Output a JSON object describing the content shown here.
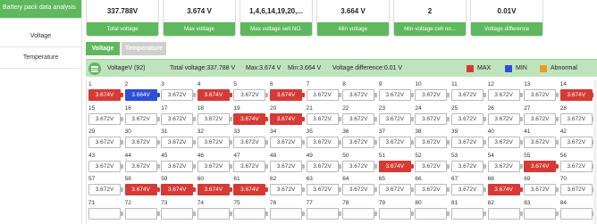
{
  "sidebar": {
    "items": [
      {
        "label": "Battery pack data analysis",
        "active": true
      },
      {
        "label": "Voltage",
        "active": false
      },
      {
        "label": "Temperature",
        "active": false
      }
    ]
  },
  "summary": [
    {
      "value": "337.788V",
      "label": "Total voltage"
    },
    {
      "value": "3.674 V",
      "label": "Max voltage"
    },
    {
      "value": "1,4,6,14,19,20,...",
      "label": "Max voltage sell NO."
    },
    {
      "value": "3.664 V",
      "label": "Min voltage"
    },
    {
      "value": "2",
      "label": "Min-voltage cell no..."
    },
    {
      "value": "0.01V",
      "label": "Voltage difference"
    }
  ],
  "tabs": {
    "active": "Voltage",
    "inactive": "Temperature"
  },
  "panel": {
    "title": "VoltageV (92)",
    "total": "Total voltage:337.788 V",
    "max": "Max:3.674 V",
    "min": "Min:3.664 V",
    "diff": "Voltage difference:0.01 V",
    "legend": [
      {
        "label": "MAX",
        "color": "#d63a35"
      },
      {
        "label": "MIN",
        "color": "#2f4fd6"
      },
      {
        "label": "Abnormal",
        "color": "#ef9a1f"
      }
    ]
  },
  "cells": [
    {
      "no": "1",
      "v": "3.674V",
      "s": "max"
    },
    {
      "no": "2",
      "v": "3.664V",
      "s": "min"
    },
    {
      "no": "3",
      "v": "3.672V",
      "s": "normal"
    },
    {
      "no": "4",
      "v": "3.674V",
      "s": "max"
    },
    {
      "no": "5",
      "v": "3.672V",
      "s": "normal"
    },
    {
      "no": "6",
      "v": "3.674V",
      "s": "max"
    },
    {
      "no": "7",
      "v": "3.672V",
      "s": "normal"
    },
    {
      "no": "8",
      "v": "3.672V",
      "s": "normal"
    },
    {
      "no": "9",
      "v": "3.672V",
      "s": "normal"
    },
    {
      "no": "10",
      "v": "3.672V",
      "s": "normal"
    },
    {
      "no": "11",
      "v": "3.672V",
      "s": "normal"
    },
    {
      "no": "12",
      "v": "3.672V",
      "s": "normal"
    },
    {
      "no": "13",
      "v": "3.672V",
      "s": "normal"
    },
    {
      "no": "14",
      "v": "3.674V",
      "s": "max"
    },
    {
      "no": "15",
      "v": "3.672V",
      "s": "normal"
    },
    {
      "no": "16",
      "v": "3.672V",
      "s": "normal"
    },
    {
      "no": "17",
      "v": "3.672V",
      "s": "normal"
    },
    {
      "no": "18",
      "v": "3.672V",
      "s": "normal"
    },
    {
      "no": "19",
      "v": "3.674V",
      "s": "max"
    },
    {
      "no": "20",
      "v": "3.674V",
      "s": "max"
    },
    {
      "no": "21",
      "v": "3.672V",
      "s": "normal"
    },
    {
      "no": "22",
      "v": "3.672V",
      "s": "normal"
    },
    {
      "no": "23",
      "v": "3.672V",
      "s": "normal"
    },
    {
      "no": "24",
      "v": "3.672V",
      "s": "normal"
    },
    {
      "no": "25",
      "v": "3.672V",
      "s": "normal"
    },
    {
      "no": "26",
      "v": "3.672V",
      "s": "normal"
    },
    {
      "no": "27",
      "v": "3.672V",
      "s": "normal"
    },
    {
      "no": "28",
      "v": "3.672V",
      "s": "normal"
    },
    {
      "no": "29",
      "v": "3.672V",
      "s": "normal"
    },
    {
      "no": "30",
      "v": "3.672V",
      "s": "normal"
    },
    {
      "no": "31",
      "v": "3.672V",
      "s": "normal"
    },
    {
      "no": "32",
      "v": "3.672V",
      "s": "normal"
    },
    {
      "no": "33",
      "v": "3.672V",
      "s": "normal"
    },
    {
      "no": "34",
      "v": "3.672V",
      "s": "normal"
    },
    {
      "no": "35",
      "v": "3.672V",
      "s": "normal"
    },
    {
      "no": "36",
      "v": "3.672V",
      "s": "normal"
    },
    {
      "no": "37",
      "v": "3.672V",
      "s": "normal"
    },
    {
      "no": "38",
      "v": "3.672V",
      "s": "normal"
    },
    {
      "no": "39",
      "v": "3.672V",
      "s": "normal"
    },
    {
      "no": "40",
      "v": "3.672V",
      "s": "normal"
    },
    {
      "no": "41",
      "v": "3.672V",
      "s": "normal"
    },
    {
      "no": "42",
      "v": "3.672V",
      "s": "normal"
    },
    {
      "no": "43",
      "v": "3.672V",
      "s": "normal"
    },
    {
      "no": "44",
      "v": "3.672V",
      "s": "normal"
    },
    {
      "no": "45",
      "v": "3.672V",
      "s": "normal"
    },
    {
      "no": "46",
      "v": "3.672V",
      "s": "normal"
    },
    {
      "no": "47",
      "v": "3.672V",
      "s": "normal"
    },
    {
      "no": "48",
      "v": "3.672V",
      "s": "normal"
    },
    {
      "no": "49",
      "v": "3.672V",
      "s": "normal"
    },
    {
      "no": "50",
      "v": "3.672V",
      "s": "normal"
    },
    {
      "no": "51",
      "v": "3.674V",
      "s": "max"
    },
    {
      "no": "52",
      "v": "3.672V",
      "s": "normal"
    },
    {
      "no": "53",
      "v": "3.672V",
      "s": "normal"
    },
    {
      "no": "54",
      "v": "3.672V",
      "s": "normal"
    },
    {
      "no": "55",
      "v": "3.674V",
      "s": "max"
    },
    {
      "no": "56",
      "v": "3.672V",
      "s": "normal"
    },
    {
      "no": "57",
      "v": "3.672V",
      "s": "normal"
    },
    {
      "no": "58",
      "v": "3.674V",
      "s": "max"
    },
    {
      "no": "59",
      "v": "3.674V",
      "s": "max"
    },
    {
      "no": "60",
      "v": "3.674V",
      "s": "max"
    },
    {
      "no": "61",
      "v": "3.674V",
      "s": "max"
    },
    {
      "no": "62",
      "v": "3.672V",
      "s": "normal"
    },
    {
      "no": "63",
      "v": "3.672V",
      "s": "normal"
    },
    {
      "no": "64",
      "v": "3.672V",
      "s": "normal"
    },
    {
      "no": "65",
      "v": "3.672V",
      "s": "normal"
    },
    {
      "no": "66",
      "v": "3.672V",
      "s": "normal"
    },
    {
      "no": "67",
      "v": "3.672V",
      "s": "normal"
    },
    {
      "no": "68",
      "v": "3.674V",
      "s": "max"
    },
    {
      "no": "69",
      "v": "3.672V",
      "s": "normal"
    },
    {
      "no": "70",
      "v": "3.672V",
      "s": "normal"
    },
    {
      "no": "71",
      "v": "",
      "s": "normal"
    },
    {
      "no": "72",
      "v": "",
      "s": "normal"
    },
    {
      "no": "73",
      "v": "",
      "s": "normal"
    },
    {
      "no": "74",
      "v": "",
      "s": "normal"
    },
    {
      "no": "75",
      "v": "",
      "s": "normal"
    },
    {
      "no": "76",
      "v": "",
      "s": "normal"
    },
    {
      "no": "77",
      "v": "",
      "s": "normal"
    },
    {
      "no": "78",
      "v": "",
      "s": "normal"
    },
    {
      "no": "79",
      "v": "",
      "s": "normal"
    },
    {
      "no": "80",
      "v": "",
      "s": "normal"
    },
    {
      "no": "81",
      "v": "",
      "s": "normal"
    },
    {
      "no": "82",
      "v": "",
      "s": "normal"
    },
    {
      "no": "83",
      "v": "",
      "s": "normal"
    },
    {
      "no": "84",
      "v": "",
      "s": "normal"
    }
  ]
}
